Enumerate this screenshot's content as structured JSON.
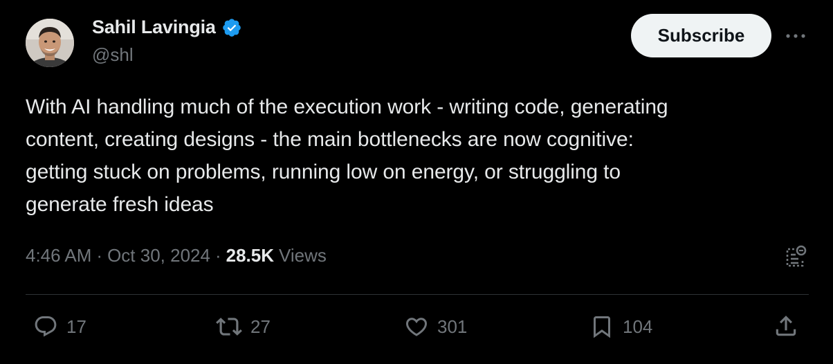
{
  "author": {
    "display_name": "Sahil Lavingia",
    "handle": "@shl",
    "verified_icon": "verified-badge-icon",
    "verified_color": "#1d9bf0"
  },
  "header": {
    "subscribe_label": "Subscribe",
    "more_icon": "more-horizontal-icon"
  },
  "tweet": {
    "text": "With AI handling much of the execution work - writing code, generating\ncontent, creating designs - the main bottlenecks are now cognitive:\ngetting stuck on problems, running low on energy, or struggling to\ngenerate fresh ideas"
  },
  "meta": {
    "time": "4:46 AM",
    "separator": "·",
    "date": "Oct 30, 2024",
    "views_count": "28.5K",
    "views_label": "Views",
    "grok_icon": "grok-analyze-icon"
  },
  "actions": {
    "replies": {
      "icon": "reply-icon",
      "count": "17"
    },
    "reposts": {
      "icon": "repost-icon",
      "count": "27"
    },
    "likes": {
      "icon": "like-icon",
      "count": "301"
    },
    "bookmarks": {
      "icon": "bookmark-icon",
      "count": "104"
    },
    "share": {
      "icon": "share-icon"
    }
  },
  "colors": {
    "background": "#000000",
    "text_primary": "#e7e9ea",
    "text_secondary": "#71767b",
    "divider": "#2f3336",
    "button_bg": "#eff3f4",
    "button_text": "#0f1419"
  }
}
